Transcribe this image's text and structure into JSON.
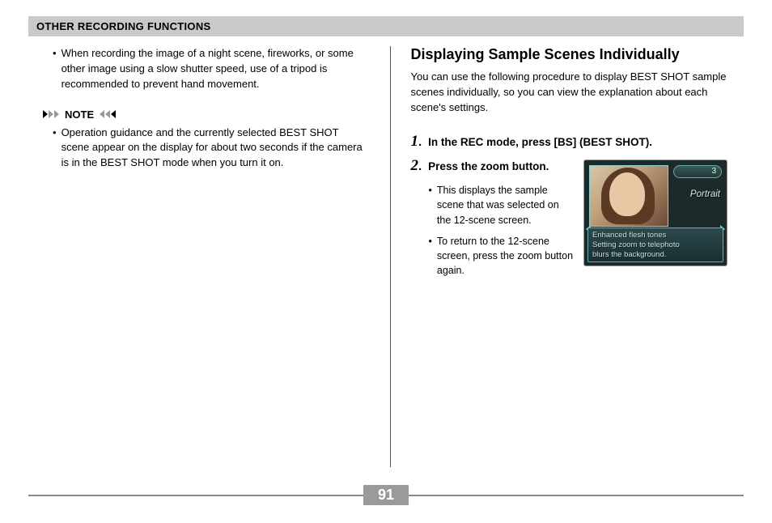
{
  "header": "OTHER RECORDING FUNCTIONS",
  "left": {
    "bullet1": "When recording the image of a night scene, fireworks, or some other image using a slow shutter speed, use of a tripod is recommended to prevent hand movement.",
    "note_label": "NOTE",
    "note_bullet": "Operation guidance and the currently selected BEST SHOT scene appear on the display for about two seconds if the camera is in the BEST SHOT mode when you turn it on."
  },
  "right": {
    "title": "Displaying Sample Scenes Individually",
    "intro": "You can use the following procedure to display BEST SHOT sample scenes individually, so you can view the explanation about each scene's settings.",
    "step1_num": "1",
    "step1_dot": ".",
    "step1_text": "In the REC mode, press [BS] (BEST SHOT).",
    "step2_num": "2",
    "step2_dot": ".",
    "step2_text": "Press the zoom button.",
    "step2_sub1": "This displays the sample scene that was selected on the 12-scene screen.",
    "step2_sub2": "To return to the 12-scene screen, press the zoom button again.",
    "lcd": {
      "badge_num": "3",
      "label": "Portrait",
      "desc_line1": "Enhanced flesh tones",
      "desc_line2": "Setting zoom to telephoto",
      "desc_line3": "blurs the background."
    }
  },
  "page_number": "91"
}
